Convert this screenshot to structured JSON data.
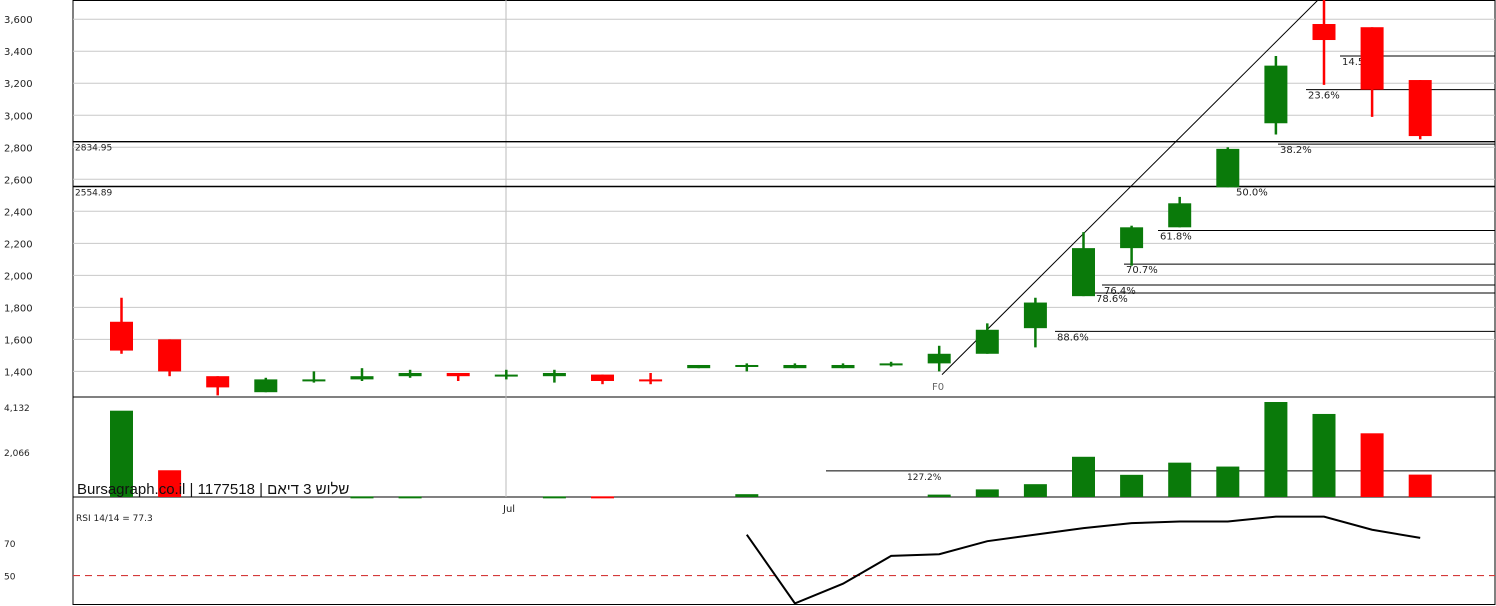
{
  "chart_data": {
    "type": "candlestick",
    "watermark": "Bursagraph.co.il | 1177518 | שלוש 3 דיאם",
    "price_axis": {
      "ticks": [
        "3,600",
        "3,400",
        "3,200",
        "3,000",
        "2,800",
        "2,600",
        "2,400",
        "2,200",
        "2,000",
        "1,800",
        "1,600",
        "1,400"
      ],
      "ylim": [
        1240,
        3720
      ]
    },
    "month_label": "Jul",
    "candles": [
      {
        "o": 1710,
        "h": 1860,
        "l": 1510,
        "c": 1530
      },
      {
        "o": 1600,
        "h": 1600,
        "l": 1370,
        "c": 1400
      },
      {
        "o": 1370,
        "h": 1370,
        "l": 1250,
        "c": 1300
      },
      {
        "o": 1270,
        "h": 1360,
        "l": 1270,
        "c": 1350
      },
      {
        "o": 1350,
        "h": 1400,
        "l": 1330,
        "c": 1350
      },
      {
        "o": 1350,
        "h": 1420,
        "l": 1340,
        "c": 1370
      },
      {
        "o": 1370,
        "h": 1410,
        "l": 1360,
        "c": 1390
      },
      {
        "o": 1390,
        "h": 1390,
        "l": 1340,
        "c": 1370
      },
      {
        "o": 1380,
        "h": 1410,
        "l": 1350,
        "c": 1380
      },
      {
        "o": 1370,
        "h": 1410,
        "l": 1330,
        "c": 1390
      },
      {
        "o": 1380,
        "h": 1380,
        "l": 1320,
        "c": 1340
      },
      {
        "o": 1350,
        "h": 1390,
        "l": 1320,
        "c": 1340
      },
      {
        "o": 1420,
        "h": 1440,
        "l": 1420,
        "c": 1440
      },
      {
        "o": 1430,
        "h": 1450,
        "l": 1400,
        "c": 1440
      },
      {
        "o": 1420,
        "h": 1450,
        "l": 1420,
        "c": 1440
      },
      {
        "o": 1420,
        "h": 1450,
        "l": 1420,
        "c": 1440
      },
      {
        "o": 1440,
        "h": 1460,
        "l": 1430,
        "c": 1450
      },
      {
        "o": 1450,
        "h": 1560,
        "l": 1400,
        "c": 1510
      },
      {
        "o": 1510,
        "h": 1700,
        "l": 1510,
        "c": 1660
      },
      {
        "o": 1670,
        "h": 1860,
        "l": 1550,
        "c": 1830
      },
      {
        "o": 1870,
        "h": 2270,
        "l": 1870,
        "c": 2170
      },
      {
        "o": 2170,
        "h": 2310,
        "l": 2060,
        "c": 2300
      },
      {
        "o": 2300,
        "h": 2490,
        "l": 2300,
        "c": 2450
      },
      {
        "o": 2550,
        "h": 2800,
        "l": 2550,
        "c": 2790
      },
      {
        "o": 2950,
        "h": 3370,
        "l": 2880,
        "c": 3310
      },
      {
        "o": 3570,
        "h": 3720,
        "l": 3190,
        "c": 3470
      },
      {
        "o": 3550,
        "h": 3550,
        "l": 2990,
        "c": 3160
      },
      {
        "o": 3220,
        "h": 3220,
        "l": 2850,
        "c": 2870
      }
    ],
    "horizontal_levels": [
      {
        "value": 2834.95,
        "label": "2834.95"
      },
      {
        "value": 2554.89,
        "label": "2554.89"
      }
    ],
    "fib_levels": [
      {
        "value": 3370,
        "label": "14.5%"
      },
      {
        "value": 3160,
        "label": "23.6%"
      },
      {
        "value": 2820,
        "label": "38.2%"
      },
      {
        "value": 2554,
        "label": "50.0%"
      },
      {
        "value": 2280,
        "label": "61.8%"
      },
      {
        "value": 2070,
        "label": "70.7%"
      },
      {
        "value": 1940,
        "label": "76.4%"
      },
      {
        "value": 1890,
        "label": "78.6%"
      },
      {
        "value": 1650,
        "label": "88.6%"
      }
    ],
    "f0_label": "F0",
    "volume": {
      "ticks": [
        "4,132",
        "2,066"
      ],
      "ymax": 4600,
      "values": [
        3970,
        1230,
        0,
        30,
        0,
        30,
        0,
        0,
        0,
        30,
        30,
        0,
        0,
        0,
        30,
        0,
        0,
        0,
        0,
        0,
        0,
        30,
        0,
        0,
        0,
        0,
        0,
        0
      ],
      "bars": [
        {
          "i": 0,
          "v": 3970,
          "up": true
        },
        {
          "i": 1,
          "v": 1230,
          "up": false
        },
        {
          "i": 5,
          "v": 30,
          "up": true
        },
        {
          "i": 6,
          "v": 30,
          "up": true
        },
        {
          "i": 9,
          "v": 30,
          "up": true
        },
        {
          "i": 10,
          "v": 30,
          "up": false
        },
        {
          "i": 13,
          "v": 130,
          "up": true
        },
        {
          "i": 17,
          "v": 110,
          "up": true
        },
        {
          "i": 18,
          "v": 350,
          "up": true
        },
        {
          "i": 19,
          "v": 590,
          "up": true
        },
        {
          "i": 20,
          "v": 1850,
          "up": true
        },
        {
          "i": 21,
          "v": 1020,
          "up": true
        },
        {
          "i": 22,
          "v": 1580,
          "up": true
        },
        {
          "i": 23,
          "v": 1400,
          "up": true
        },
        {
          "i": 24,
          "v": 4370,
          "up": true
        },
        {
          "i": 25,
          "v": 3820,
          "up": true
        },
        {
          "i": 26,
          "v": 2930,
          "up": false
        },
        {
          "i": 27,
          "v": 1030,
          "up": false
        }
      ],
      "level": {
        "value": 1200,
        "label": "127.2%"
      }
    },
    "rsi": {
      "label": "RSI 14/14 = 77.3",
      "ticks": [
        "70",
        "50"
      ],
      "ylim": [
        32,
        98
      ],
      "values": [
        {
          "i": 14,
          "v": 75
        },
        {
          "i": 15,
          "v": 33
        },
        {
          "i": 16,
          "v": 45
        },
        {
          "i": 17,
          "v": 62
        },
        {
          "i": 18,
          "v": 63
        },
        {
          "i": 19,
          "v": 71
        },
        {
          "i": 20,
          "v": 75
        },
        {
          "i": 21,
          "v": 79
        },
        {
          "i": 22,
          "v": 82
        },
        {
          "i": 23,
          "v": 83
        },
        {
          "i": 24,
          "v": 83
        },
        {
          "i": 25,
          "v": 86
        },
        {
          "i": 26,
          "v": 86
        },
        {
          "i": 27,
          "v": 78
        },
        {
          "i": 28,
          "v": 73
        }
      ]
    },
    "colors": {
      "up": "#0a7a0a",
      "down": "#ff0000",
      "rsi_ref": "#d43a3a"
    }
  }
}
